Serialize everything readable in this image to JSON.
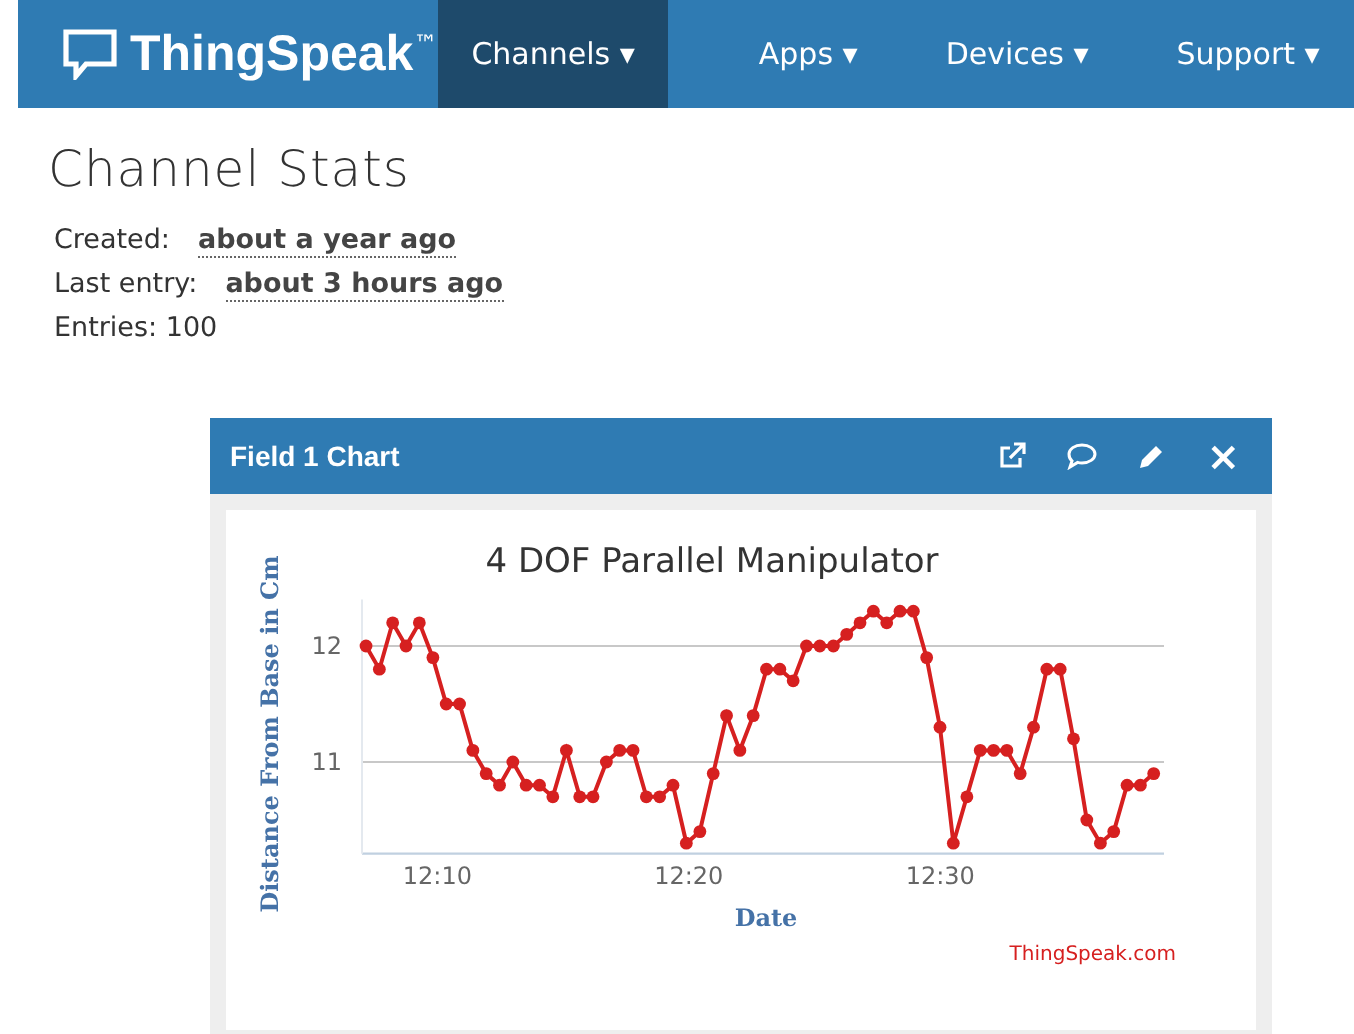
{
  "navbar": {
    "logo": "ThingSpeak",
    "trademark": "™",
    "items": [
      {
        "label": "Channels",
        "selected": true,
        "caret": "▾"
      },
      {
        "label": "Apps",
        "selected": false,
        "caret": "▾"
      },
      {
        "label": "Devices",
        "selected": false,
        "caret": "▾"
      },
      {
        "label": "Support",
        "selected": false,
        "caret": "▾"
      }
    ]
  },
  "heading": "Channel Stats",
  "stats": [
    {
      "label": "Created:",
      "value": "about a year ago"
    },
    {
      "label": "Last entry:",
      "value": "about 3 hours ago"
    },
    {
      "label": "Entries: 100"
    }
  ],
  "panel": {
    "title": "Field 1 Chart",
    "close": "×",
    "credit": "ThingSpeak.com",
    "chart_data": {
      "type": "line",
      "title": "4 DOF Parallel Manipulator",
      "xlabel": "Date",
      "ylabel": "Distance From Base in Cm",
      "x": [
        727.16,
        727.69,
        728.22,
        728.75,
        729.28,
        729.82,
        730.35,
        730.88,
        731.41,
        731.94,
        732.47,
        733.0,
        733.53,
        734.06,
        734.59,
        735.13,
        735.66,
        736.19,
        736.72,
        737.25,
        737.78,
        738.31,
        738.84,
        739.37,
        739.9,
        740.44,
        740.97,
        741.5,
        742.03,
        742.56,
        743.09,
        743.62,
        744.15,
        744.68,
        745.21,
        745.75,
        746.28,
        746.81,
        747.34,
        747.87,
        748.4,
        748.93,
        749.46,
        749.99,
        750.52,
        751.06,
        751.59,
        752.12,
        752.65,
        753.18,
        753.71,
        754.24,
        754.77,
        755.3,
        755.83,
        756.37,
        756.9,
        757.43,
        757.96,
        758.49
      ],
      "series": [
        {
          "color": "#d62020",
          "marker": "circle",
          "values": [
            12.0,
            11.8,
            12.2,
            12.0,
            12.2,
            11.9,
            11.5,
            11.5,
            11.1,
            10.9,
            10.8,
            11.0,
            10.8,
            10.8,
            10.7,
            11.1,
            10.7,
            10.7,
            11.0,
            11.1,
            11.1,
            10.7,
            10.7,
            10.8,
            10.3,
            10.4,
            10.9,
            11.4,
            11.1,
            11.4,
            11.8,
            11.8,
            11.7,
            12.0,
            12.0,
            12.0,
            12.1,
            12.2,
            12.3,
            12.2,
            12.3,
            12.3,
            11.9,
            11.3,
            10.3,
            10.7,
            11.1,
            11.1,
            11.1,
            10.9,
            11.3,
            11.8,
            11.8,
            11.2,
            10.5,
            10.3,
            10.4,
            10.8,
            10.8,
            10.9
          ]
        }
      ],
      "xlim": [
        727,
        758.9
      ],
      "ylim": [
        10.21,
        12.4
      ],
      "xticks": [
        {
          "value": 730,
          "label": "12:10"
        },
        {
          "value": 740,
          "label": "12:20"
        },
        {
          "value": 750,
          "label": "12:30"
        }
      ],
      "yticks": [
        11,
        12
      ]
    }
  }
}
